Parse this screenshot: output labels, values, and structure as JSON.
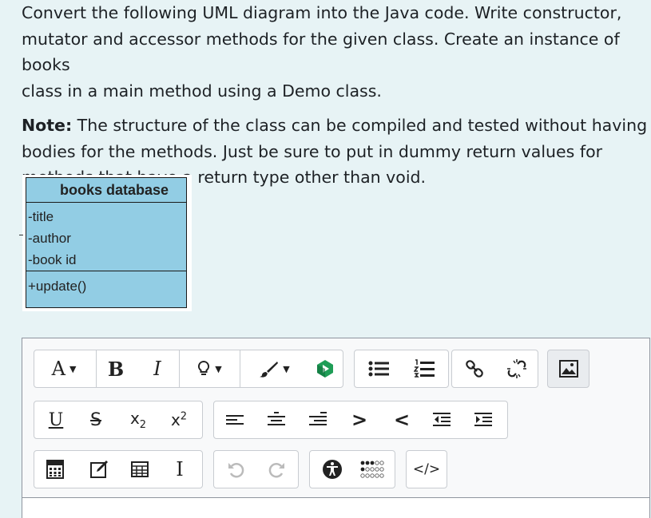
{
  "question": {
    "line1": "Convert the following UML diagram into the Java code. Write constructor,",
    "line2": "mutator and accessor methods for the given class. Create an instance of books",
    "line3": "class  in a main method using a Demo class.",
    "note_label": "Note:",
    "note_line1": " The structure of the class can be compiled and tested without having",
    "note_line2": "bodies for the methods. Just be sure to put in dummy return values for",
    "note_line3": "methods that have a return type other than void."
  },
  "uml": {
    "class_name": "books database",
    "attributes": [
      "-title",
      "-author",
      "-book id"
    ],
    "operations": [
      "+update()"
    ]
  },
  "toolbar": {
    "font_glyph": "A",
    "bold_glyph": "B",
    "italic_glyph": "I",
    "underline_glyph": "U",
    "strike_glyph": "S",
    "subscript_base": "x",
    "subscript_mark": "2",
    "superscript_base": "x",
    "superscript_mark": "2",
    "outdent_glyph": ">",
    "indent_glyph": "<",
    "html_glyph": "</>",
    "cursor_glyph": "I",
    "dropdown_caret": "▼"
  }
}
